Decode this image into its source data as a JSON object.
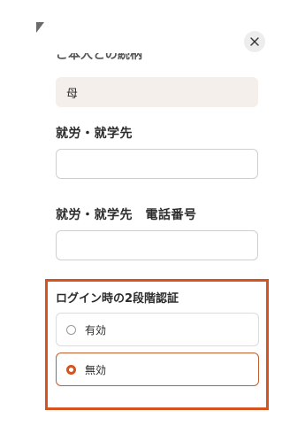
{
  "header": {
    "close_icon": "close-icon"
  },
  "relationship_field": {
    "label_partial": "ご本人との続柄",
    "value": "母"
  },
  "workplace": {
    "label": "就労・就学先",
    "value": ""
  },
  "workplace_phone": {
    "label": "就労・就学先　電話番号",
    "value": ""
  },
  "two_factor": {
    "label": "ログイン時の2段階認証",
    "options": [
      {
        "label": "有効",
        "selected": false
      },
      {
        "label": "無効",
        "selected": true
      }
    ],
    "highlight_color": "#d5531f"
  }
}
